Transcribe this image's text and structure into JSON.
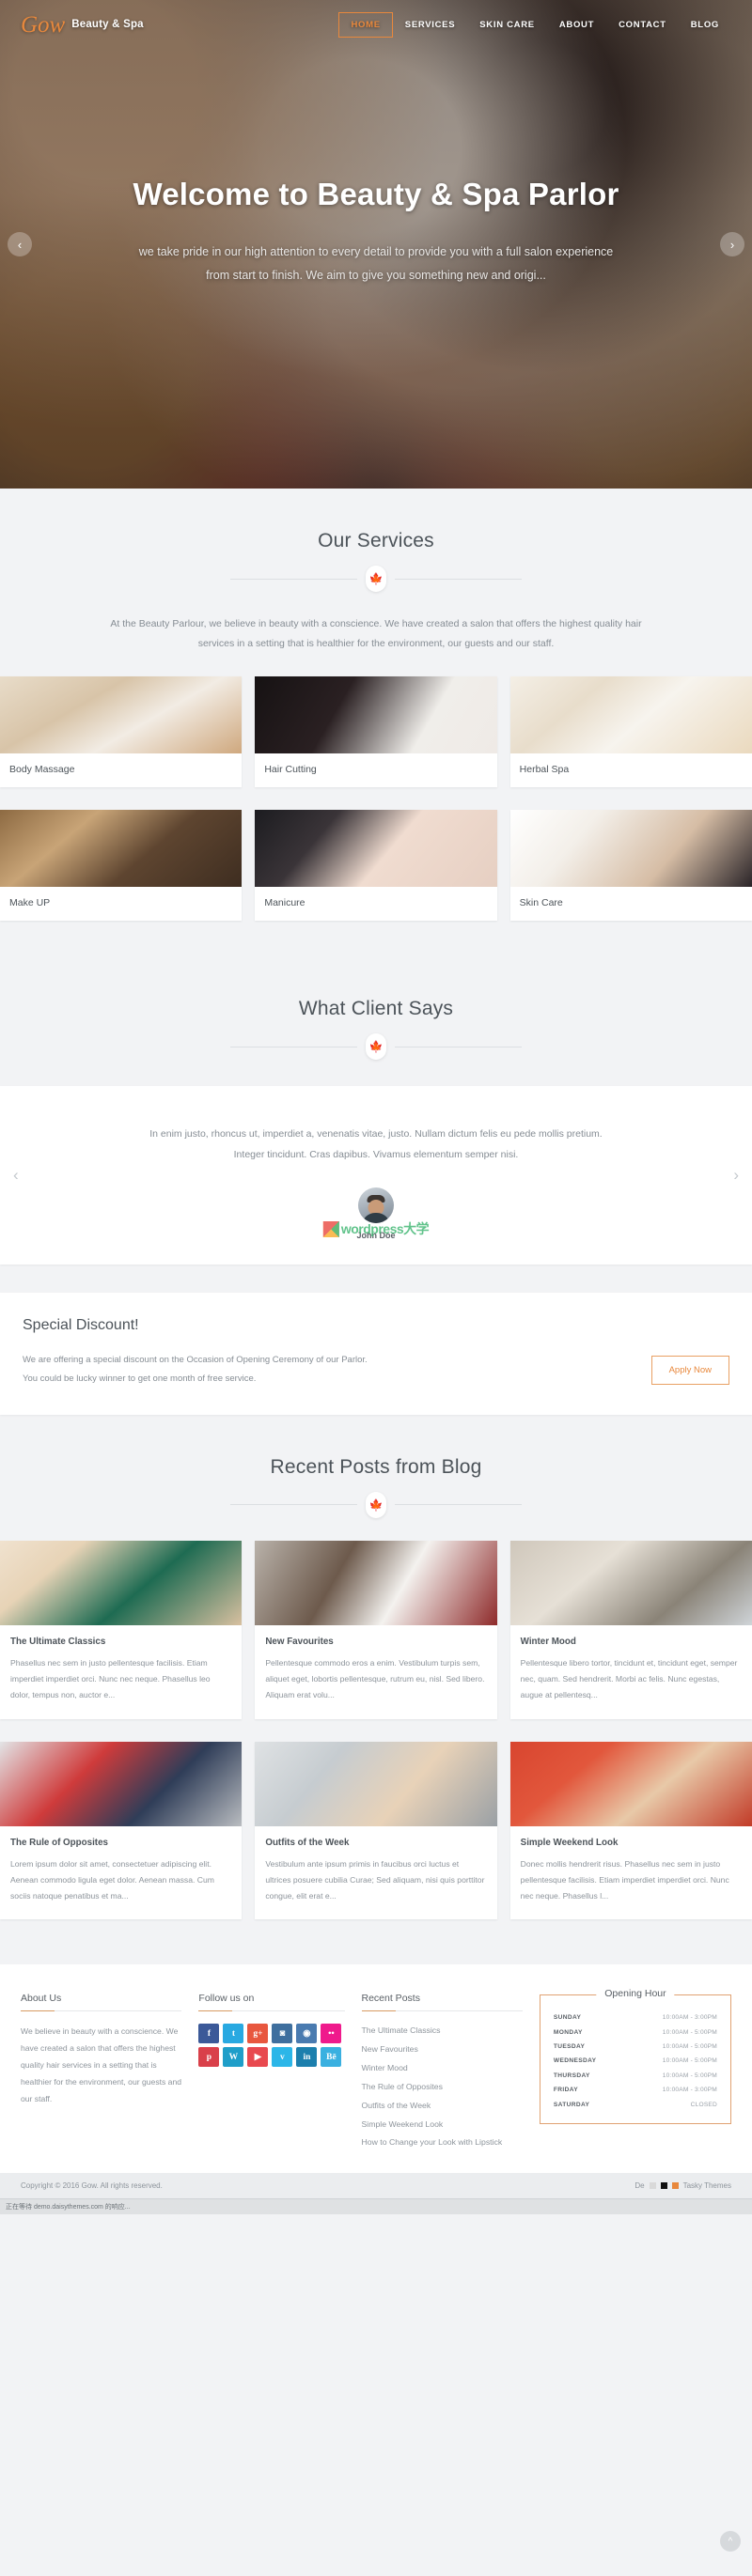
{
  "nav": {
    "brand_mark": "Gow",
    "brand_text": "Beauty & Spa",
    "links": [
      {
        "label": "HOME",
        "active": true
      },
      {
        "label": "SERVICES",
        "active": false
      },
      {
        "label": "SKIN CARE",
        "active": false
      },
      {
        "label": "ABOUT",
        "active": false
      },
      {
        "label": "CONTACT",
        "active": false
      },
      {
        "label": "BLOG",
        "active": false
      }
    ]
  },
  "hero": {
    "title": "Welcome to Beauty & Spa Parlor",
    "subtitle_line1": "we take pride in our high attention to every detail to provide you with a full salon experience",
    "subtitle_line2": "from start to finish. We aim to give you something new and origi...",
    "prev_icon": "chevron-left-icon",
    "next_icon": "chevron-right-icon"
  },
  "services": {
    "title": "Our Services",
    "intro_line1": "At the Beauty Parlour, we believe in beauty with a conscience. We have created a salon that offers the highest",
    "intro_line2": "quality hair services in a setting that is healthier for the environment, our guests and our staff.",
    "items": [
      {
        "label": "Body Massage"
      },
      {
        "label": "Hair Cutting"
      },
      {
        "label": "Herbal Spa"
      },
      {
        "label": "Make UP"
      },
      {
        "label": "Manicure"
      },
      {
        "label": "Skin Care"
      }
    ]
  },
  "testimonials": {
    "title": "What Client Says",
    "quote_line1": "In enim justo, rhoncus ut, imperdiet a, venenatis vitae, justo. Nullam dictum felis eu pede mollis pretium.",
    "quote_line2": "Integer tincidunt. Cras dapibus. Vivamus elementum semper nisi.",
    "author": "John Doe",
    "watermark": "wordpress大学",
    "prev_icon": "chevron-left-icon",
    "next_icon": "chevron-right-icon"
  },
  "discount": {
    "title": "Special Discount!",
    "text_line1": "We are offering a special discount on the Occasion of Opening Ceremony of our Parlor.",
    "text_line2": "You could be lucky winner to get one month of free service.",
    "button": "Apply Now"
  },
  "blog": {
    "title": "Recent Posts from Blog",
    "posts": [
      {
        "title": "The Ultimate Classics",
        "excerpt": "Phasellus nec sem in justo pellentesque facilisis. Etiam imperdiet imperdiet orci. Nunc nec neque. Phasellus leo dolor, tempus non, auctor e..."
      },
      {
        "title": "New Favourites",
        "excerpt": "Pellentesque commodo eros a enim. Vestibulum turpis sem, aliquet eget, lobortis pellentesque, rutrum eu, nisl. Sed libero. Aliquam erat volu..."
      },
      {
        "title": "Winter Mood",
        "excerpt": "Pellentesque libero tortor, tincidunt et, tincidunt eget, semper nec, quam. Sed hendrerit. Morbi ac felis. Nunc egestas, augue at pellentesq..."
      },
      {
        "title": "The Rule of Opposites",
        "excerpt": "Lorem ipsum dolor sit amet, consectetuer adipiscing elit. Aenean commodo ligula eget dolor. Aenean massa. Cum sociis natoque penatibus et ma..."
      },
      {
        "title": "Outfits of the Week",
        "excerpt": "Vestibulum ante ipsum primis in faucibus orci luctus et ultrices posuere cubilia Curae; Sed aliquam, nisi quis porttitor congue, elit erat e..."
      },
      {
        "title": "Simple Weekend Look",
        "excerpt": "Donec mollis hendrerit risus. Phasellus nec sem in justo pellentesque facilisis. Etiam imperdiet imperdiet orci. Nunc nec neque. Phasellus l..."
      }
    ]
  },
  "footer": {
    "about": {
      "heading": "About Us",
      "text": "We believe in beauty with a conscience. We have created a salon that offers the highest quality hair services in a setting that is healthier for the environment, our guests and our staff."
    },
    "follow": {
      "heading": "Follow us on",
      "icons": [
        {
          "name": "facebook-icon",
          "glyph": "f",
          "color": "#3b5998"
        },
        {
          "name": "twitter-icon",
          "glyph": "t",
          "color": "#29a9e1"
        },
        {
          "name": "google-plus-icon",
          "glyph": "g+",
          "color": "#e8573f"
        },
        {
          "name": "instagram-icon",
          "glyph": "◙",
          "color": "#3f6f9e"
        },
        {
          "name": "github-icon",
          "glyph": "◉",
          "color": "#4a7bb0"
        },
        {
          "name": "flickr-icon",
          "glyph": "••",
          "color": "#ef1a8c"
        },
        {
          "name": "pinterest-icon",
          "glyph": "p",
          "color": "#d9404a"
        },
        {
          "name": "wordpress-icon",
          "glyph": "W",
          "color": "#1f9ec9"
        },
        {
          "name": "youtube-icon",
          "glyph": "▶",
          "color": "#e8494f"
        },
        {
          "name": "vimeo-icon",
          "glyph": "v",
          "color": "#2cb6e8"
        },
        {
          "name": "linkedin-icon",
          "glyph": "in",
          "color": "#1c7fad"
        },
        {
          "name": "behance-icon",
          "glyph": "Bē",
          "color": "#3ab0e0"
        }
      ]
    },
    "recent": {
      "heading": "Recent Posts",
      "links": [
        "The Ultimate Classics",
        "New Favourites",
        "Winter Mood",
        "The Rule of Opposites",
        "Outfits of the Week",
        "Simple Weekend Look",
        "How to Change your Look with Lipstick"
      ]
    },
    "hours": {
      "heading": "Opening Hour",
      "rows": [
        {
          "day": "SUNDAY",
          "time": "10:00AM - 3:00PM"
        },
        {
          "day": "MONDAY",
          "time": "10:00AM - 5:00PM"
        },
        {
          "day": "TUESDAY",
          "time": "10:00AM - 5:00PM"
        },
        {
          "day": "WEDNESDAY",
          "time": "10:00AM - 5:00PM"
        },
        {
          "day": "THURSDAY",
          "time": "10:00AM - 5:00PM"
        },
        {
          "day": "FRIDAY",
          "time": "10:00AM - 3:00PM"
        },
        {
          "day": "SATURDAY",
          "time": "CLOSED"
        }
      ]
    },
    "copyright": "Copyright © 2016 Gow. All rights reserved.",
    "credit_left": "De",
    "credit_right": "Tasky Themes",
    "to_top_icon": "chevron-up-icon"
  },
  "taskbar": "正在等待 demo.daisythemes.com 的响应...",
  "colors": {
    "accent": "#e8883c",
    "accent_border": "#e0a272",
    "heading": "#4c5359",
    "body_text": "#868d94",
    "page_bg": "#f2f3f5"
  }
}
